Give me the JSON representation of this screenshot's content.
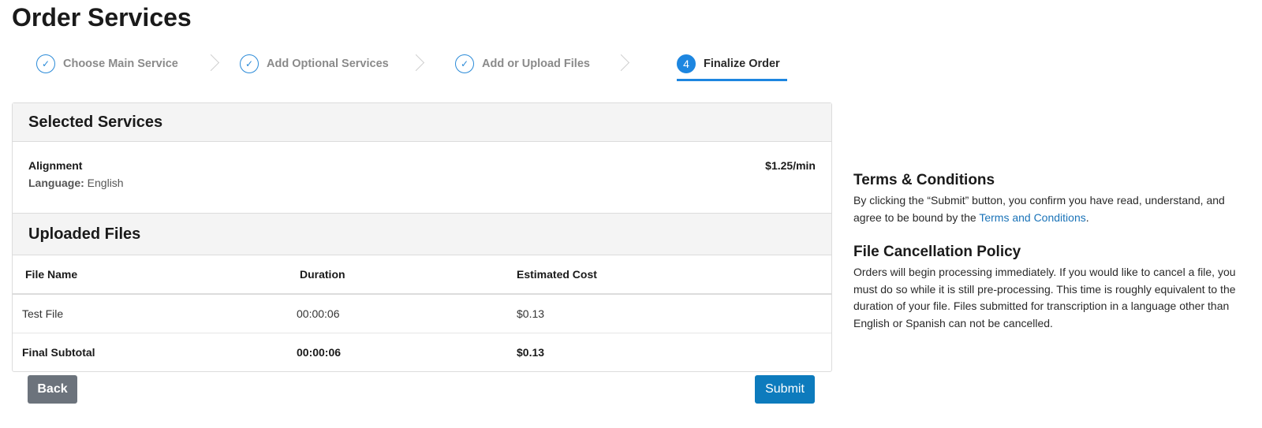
{
  "page": {
    "title": "Order Services"
  },
  "stepper": {
    "steps": [
      {
        "number": "✓",
        "label": "Choose Main Service",
        "state": "complete"
      },
      {
        "number": "✓",
        "label": "Add Optional Services",
        "state": "complete"
      },
      {
        "number": "✓",
        "label": "Add or Upload Files",
        "state": "complete"
      },
      {
        "number": "4",
        "label": "Finalize Order",
        "state": "active"
      }
    ]
  },
  "selected_services": {
    "heading": "Selected Services",
    "service_name": "Alignment",
    "language_key": "Language:",
    "language_value": "English",
    "price": "$1.25/min"
  },
  "uploaded_files": {
    "heading": "Uploaded Files",
    "columns": [
      "File Name",
      "Duration",
      "Estimated Cost"
    ],
    "rows": [
      {
        "file_name": "Test File",
        "duration": "00:00:06",
        "cost": "$0.13"
      }
    ],
    "subtotal": {
      "label": "Final Subtotal",
      "duration": "00:00:06",
      "cost": "$0.13"
    }
  },
  "buttons": {
    "back": "Back",
    "submit": "Submit"
  },
  "terms": {
    "heading": "Terms & Conditions",
    "text_before": "By clicking the “Submit” button, you confirm you have read, understand, and agree to be bound by the ",
    "link": "Terms and Conditions",
    "text_after": "."
  },
  "cancellation": {
    "heading": "File Cancellation Policy",
    "text": "Orders will begin processing immediately. If you would like to cancel a file, you must do so while it is still pre-processing. This time is roughly equivalent to the duration of your file. Files submitted for transcription in a language other than English or Spanish can not be cancelled."
  },
  "colors": {
    "accent": "#1d86e0",
    "submit_button": "#0d7bbd",
    "back_button": "#6c737c",
    "link": "#1a73b8"
  }
}
